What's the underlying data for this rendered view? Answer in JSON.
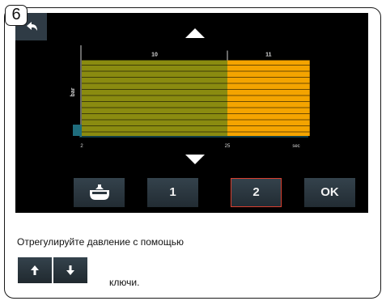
{
  "step_number": "6",
  "icons": {
    "back": "return-arrow-icon",
    "scroll_up": "triangle-up-icon",
    "scroll_down": "triangle-down-icon",
    "reservoir": "reservoir-icon",
    "key_up": "arrow-up-icon",
    "key_down": "arrow-down-icon"
  },
  "chart_data": {
    "type": "bar",
    "segments": [
      {
        "label": "10",
        "start": 2,
        "end": 25,
        "color": "#8a8b10"
      },
      {
        "label": "11",
        "start": 25,
        "end": 38,
        "color": "#f4a400"
      }
    ],
    "x_ticks": [
      "2",
      "25",
      "sec"
    ],
    "y_label": "bar",
    "xlim": [
      0,
      38
    ],
    "y_level_fraction": 0.85,
    "stripes": true
  },
  "buttons": {
    "one": "1",
    "two": "2",
    "ok": "OK",
    "selected": "2"
  },
  "colors": {
    "selected_border": "#d94030",
    "screen_bg": "#000000",
    "button_bg": "#2c3840"
  },
  "instruction": {
    "text": "Отрегулируйте давление с помощью",
    "keys_word": "ключи."
  }
}
